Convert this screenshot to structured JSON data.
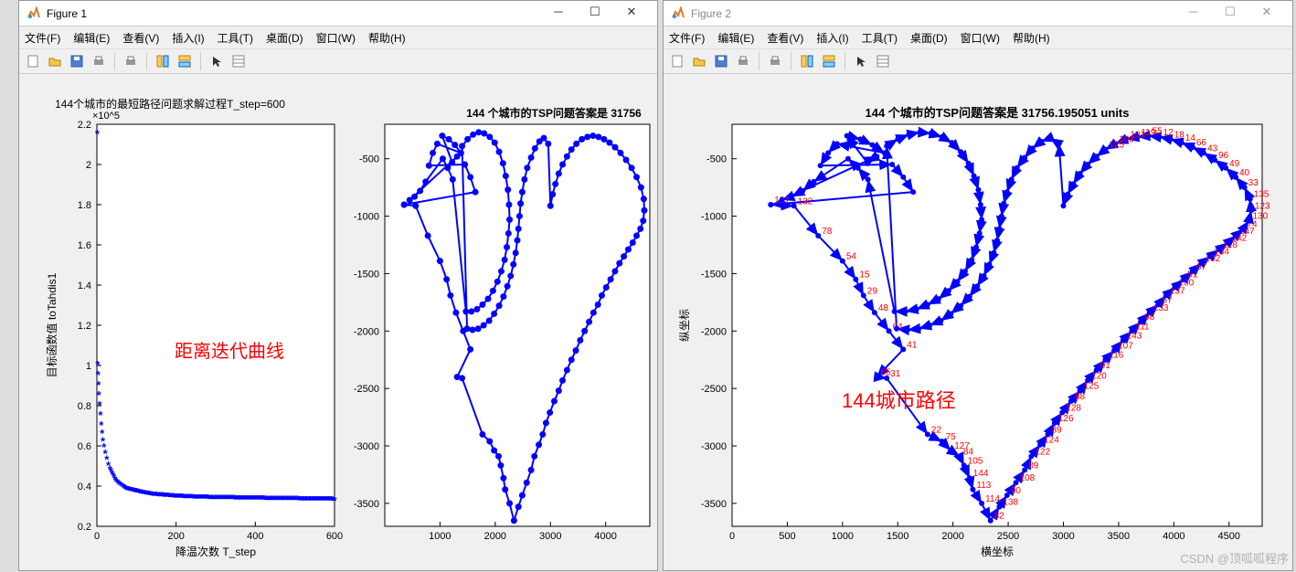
{
  "figure1": {
    "title": "Figure 1",
    "menu": {
      "file": "文件(F)",
      "edit": "编辑(E)",
      "view": "查看(V)",
      "insert": "插入(I)",
      "tools": "工具(T)",
      "desktop": "桌面(D)",
      "window": "窗口(W)",
      "help": "帮助(H)"
    },
    "annotation1": "距离迭代曲线"
  },
  "figure2": {
    "title": "Figure 2",
    "menu": {
      "file": "文件(F)",
      "edit": "编辑(E)",
      "view": "查看(V)",
      "insert": "插入(I)",
      "tools": "工具(T)",
      "desktop": "桌面(D)",
      "window": "窗口(W)",
      "help": "帮助(H)"
    },
    "annotation1": "144城市路径"
  },
  "watermark": "CSDN @顶呱呱程序",
  "chart_data": [
    {
      "id": "fig1-left",
      "type": "scatter",
      "title": "144个城市的最短路径问题求解过程T_step=600",
      "y_scale_label": "×10^5",
      "xlabel": "降温次数 T_step",
      "ylabel": "目标函数值 toTahdis1",
      "xlim": [
        0,
        600
      ],
      "ylim": [
        0.2,
        2.2
      ],
      "xticks": [
        0,
        200,
        400,
        600
      ],
      "yticks": [
        0.2,
        0.4,
        0.6,
        0.8,
        1.0,
        1.2,
        1.4,
        1.6,
        1.8,
        2.0,
        2.2
      ],
      "x": [
        1,
        2,
        3,
        4,
        5,
        7,
        9,
        11,
        13,
        15,
        18,
        21,
        25,
        29,
        33,
        38,
        43,
        48,
        54,
        60,
        67,
        75,
        84,
        94,
        105,
        117,
        130,
        145,
        161,
        178,
        197,
        217,
        239,
        263,
        289,
        317,
        347,
        379,
        413,
        449,
        487,
        527,
        569,
        600
      ],
      "y_e5": [
        2.15,
        1.0,
        0.95,
        0.9,
        0.85,
        0.8,
        0.75,
        0.7,
        0.66,
        0.62,
        0.59,
        0.56,
        0.53,
        0.5,
        0.48,
        0.46,
        0.44,
        0.42,
        0.41,
        0.4,
        0.39,
        0.38,
        0.375,
        0.37,
        0.365,
        0.36,
        0.355,
        0.35,
        0.348,
        0.345,
        0.342,
        0.34,
        0.338,
        0.336,
        0.335,
        0.334,
        0.333,
        0.332,
        0.331,
        0.33,
        0.329,
        0.328,
        0.327,
        0.326
      ],
      "marker": "*",
      "color": "#0000ff"
    },
    {
      "id": "fig1-right",
      "type": "line",
      "title": "144 个城市的TSP问题答案是  31756",
      "xlim": [
        0,
        4800
      ],
      "ylim": [
        -3700,
        -200
      ],
      "xticks": [
        1000,
        2000,
        3000,
        4000
      ],
      "yticks": [
        -3500,
        -3000,
        -2500,
        -2000,
        -1500,
        -1000,
        -500
      ],
      "comment": "144-node path same as fig2-main",
      "color": "#0000ff"
    },
    {
      "id": "fig2-main",
      "type": "line",
      "title": "144 个城市的TSP问题答案是  31756.195051 units",
      "xlabel": "横坐标",
      "ylabel": "纵坐标",
      "xlim": [
        0,
        4800
      ],
      "ylim": [
        -3700,
        -200
      ],
      "xticks": [
        0,
        500,
        1000,
        1500,
        2000,
        2500,
        3000,
        3500,
        4000,
        4500
      ],
      "yticks": [
        -3500,
        -3000,
        -2500,
        -2000,
        -1500,
        -1000,
        -500
      ],
      "color": "#0000ff",
      "path_xy": [
        [
          350,
          -900
        ],
        [
          560,
          -910
        ],
        [
          780,
          -1170
        ],
        [
          1000,
          -1390
        ],
        [
          1120,
          -1550
        ],
        [
          1190,
          -1690
        ],
        [
          1290,
          -1840
        ],
        [
          1420,
          -2000
        ],
        [
          1550,
          -2160
        ],
        [
          1310,
          -2400
        ],
        [
          1400,
          -2410
        ],
        [
          1770,
          -2900
        ],
        [
          1900,
          -2960
        ],
        [
          1980,
          -3040
        ],
        [
          2060,
          -3090
        ],
        [
          2100,
          -3170
        ],
        [
          2150,
          -3280
        ],
        [
          2180,
          -3380
        ],
        [
          2260,
          -3500
        ],
        [
          2340,
          -3650
        ],
        [
          2420,
          -3530
        ],
        [
          2490,
          -3430
        ],
        [
          2570,
          -3320
        ],
        [
          2650,
          -3210
        ],
        [
          2710,
          -3090
        ],
        [
          2790,
          -2990
        ],
        [
          2860,
          -2900
        ],
        [
          2920,
          -2800
        ],
        [
          2990,
          -2710
        ],
        [
          3070,
          -2610
        ],
        [
          3150,
          -2520
        ],
        [
          3220,
          -2430
        ],
        [
          3300,
          -2340
        ],
        [
          3380,
          -2250
        ],
        [
          3460,
          -2170
        ],
        [
          3540,
          -2080
        ],
        [
          3620,
          -2000
        ],
        [
          3700,
          -1920
        ],
        [
          3780,
          -1840
        ],
        [
          3860,
          -1770
        ],
        [
          3930,
          -1690
        ],
        [
          4010,
          -1620
        ],
        [
          4090,
          -1550
        ],
        [
          4170,
          -1480
        ],
        [
          4250,
          -1410
        ],
        [
          4330,
          -1350
        ],
        [
          4410,
          -1290
        ],
        [
          4490,
          -1230
        ],
        [
          4560,
          -1170
        ],
        [
          4630,
          -1110
        ],
        [
          4680,
          -1040
        ],
        [
          4700,
          -950
        ],
        [
          4690,
          -850
        ],
        [
          4640,
          -750
        ],
        [
          4560,
          -660
        ],
        [
          4470,
          -580
        ],
        [
          4370,
          -510
        ],
        [
          4270,
          -450
        ],
        [
          4170,
          -400
        ],
        [
          4070,
          -360
        ],
        [
          3970,
          -330
        ],
        [
          3870,
          -310
        ],
        [
          3770,
          -300
        ],
        [
          3670,
          -310
        ],
        [
          3570,
          -330
        ],
        [
          3470,
          -370
        ],
        [
          3380,
          -420
        ],
        [
          3300,
          -480
        ],
        [
          3220,
          -550
        ],
        [
          3150,
          -630
        ],
        [
          3090,
          -720
        ],
        [
          3040,
          -810
        ],
        [
          3000,
          -910
        ],
        [
          2960,
          -370
        ],
        [
          2880,
          -320
        ],
        [
          2800,
          -350
        ],
        [
          2720,
          -410
        ],
        [
          2650,
          -490
        ],
        [
          2580,
          -580
        ],
        [
          2530,
          -680
        ],
        [
          2490,
          -790
        ],
        [
          2460,
          -890
        ],
        [
          2440,
          -1000
        ],
        [
          2420,
          -1110
        ],
        [
          2400,
          -1210
        ],
        [
          2370,
          -1320
        ],
        [
          2330,
          -1420
        ],
        [
          2280,
          -1520
        ],
        [
          2220,
          -1610
        ],
        [
          2150,
          -1700
        ],
        [
          2070,
          -1780
        ],
        [
          1980,
          -1850
        ],
        [
          1890,
          -1910
        ],
        [
          1790,
          -1950
        ],
        [
          1690,
          -1980
        ],
        [
          1590,
          -1990
        ],
        [
          1490,
          -1980
        ],
        [
          1400,
          -390
        ],
        [
          1500,
          -330
        ],
        [
          1600,
          -290
        ],
        [
          1700,
          -270
        ],
        [
          1800,
          -280
        ],
        [
          1900,
          -310
        ],
        [
          1990,
          -360
        ],
        [
          2070,
          -440
        ],
        [
          2140,
          -540
        ],
        [
          2190,
          -650
        ],
        [
          2230,
          -770
        ],
        [
          2250,
          -900
        ],
        [
          2260,
          -1030
        ],
        [
          2240,
          -1150
        ],
        [
          2210,
          -1270
        ],
        [
          2170,
          -1380
        ],
        [
          2110,
          -1480
        ],
        [
          2040,
          -1570
        ],
        [
          1960,
          -1650
        ],
        [
          1870,
          -1720
        ],
        [
          1770,
          -1770
        ],
        [
          1670,
          -1810
        ],
        [
          1570,
          -1830
        ],
        [
          1470,
          -1830
        ],
        [
          1230,
          -680
        ],
        [
          1140,
          -580
        ],
        [
          1050,
          -500
        ],
        [
          740,
          -700
        ],
        [
          640,
          -780
        ],
        [
          540,
          -830
        ],
        [
          450,
          -860
        ],
        [
          1310,
          -480
        ],
        [
          1220,
          -530
        ],
        [
          1040,
          -300
        ],
        [
          1160,
          -330
        ],
        [
          1270,
          -380
        ],
        [
          1380,
          -450
        ],
        [
          950,
          -370
        ],
        [
          870,
          -450
        ],
        [
          800,
          -560
        ],
        [
          1450,
          -550
        ],
        [
          1550,
          -660
        ],
        [
          1640,
          -790
        ],
        [
          350,
          -900
        ]
      ],
      "labels": [
        "121",
        "132",
        "78",
        "54",
        "15",
        "29",
        "48",
        "64",
        "41",
        "65",
        "31",
        "22",
        "75",
        "127",
        "84",
        "105",
        "144",
        "113",
        "114",
        "82",
        "138",
        "90",
        "108",
        "89",
        "122",
        "124",
        "39",
        "126",
        "128",
        "88",
        "125",
        "120",
        "91",
        "116",
        "107",
        "143",
        "111",
        "98",
        "133",
        "57",
        "137",
        "100",
        "51",
        "67",
        "102",
        "134",
        "118",
        "142",
        "147",
        "74",
        "130",
        "123",
        "135",
        "33",
        "40",
        "49",
        "96",
        "43",
        "66",
        "14",
        "18",
        "12",
        "55",
        "119",
        "101",
        "103",
        "125"
      ]
    }
  ]
}
